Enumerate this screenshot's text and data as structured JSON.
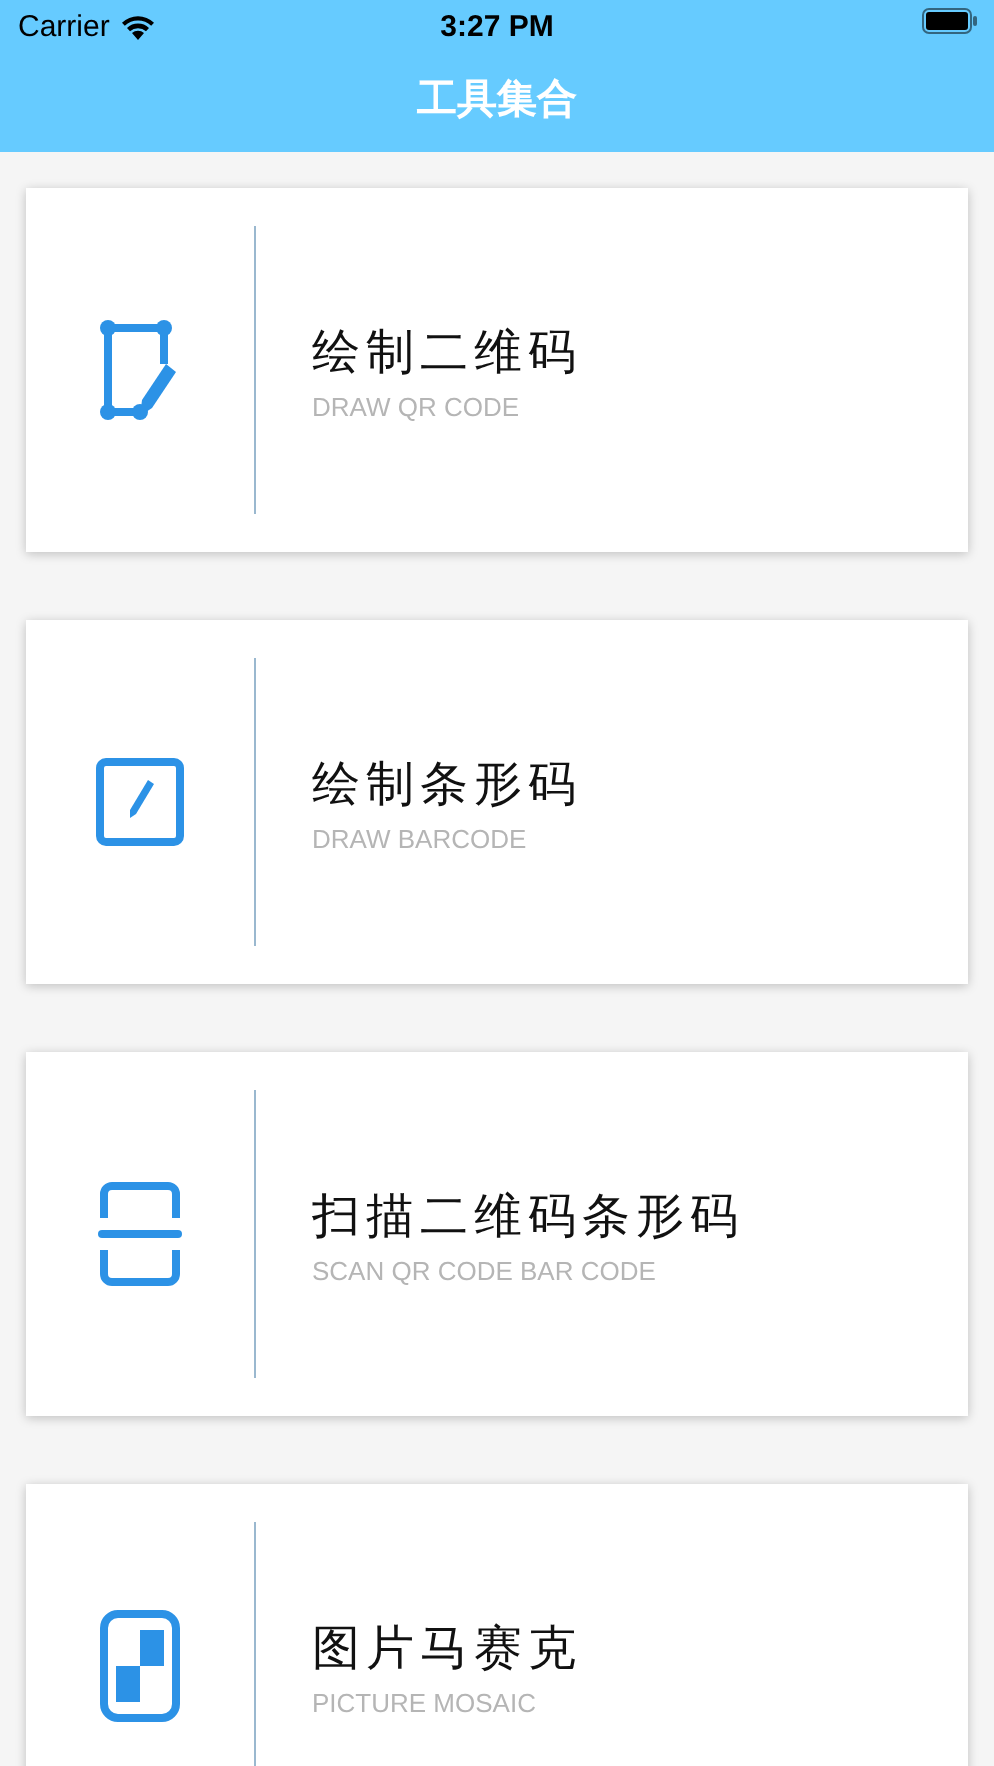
{
  "status_bar": {
    "carrier": "Carrier",
    "time": "3:27 PM"
  },
  "nav_bar": {
    "title": "工具集合"
  },
  "tools": [
    {
      "kind": "qr",
      "title": "绘制二维码",
      "subtitle": "DRAW QR CODE"
    },
    {
      "kind": "barcode",
      "title": "绘制条形码",
      "subtitle": "DRAW BARCODE"
    },
    {
      "kind": "scan",
      "title": "扫描二维码条形码",
      "subtitle": "SCAN QR CODE BAR CODE"
    },
    {
      "kind": "mosaic",
      "title": "图片马赛克",
      "subtitle": "PICTURE MOSAIC"
    }
  ]
}
